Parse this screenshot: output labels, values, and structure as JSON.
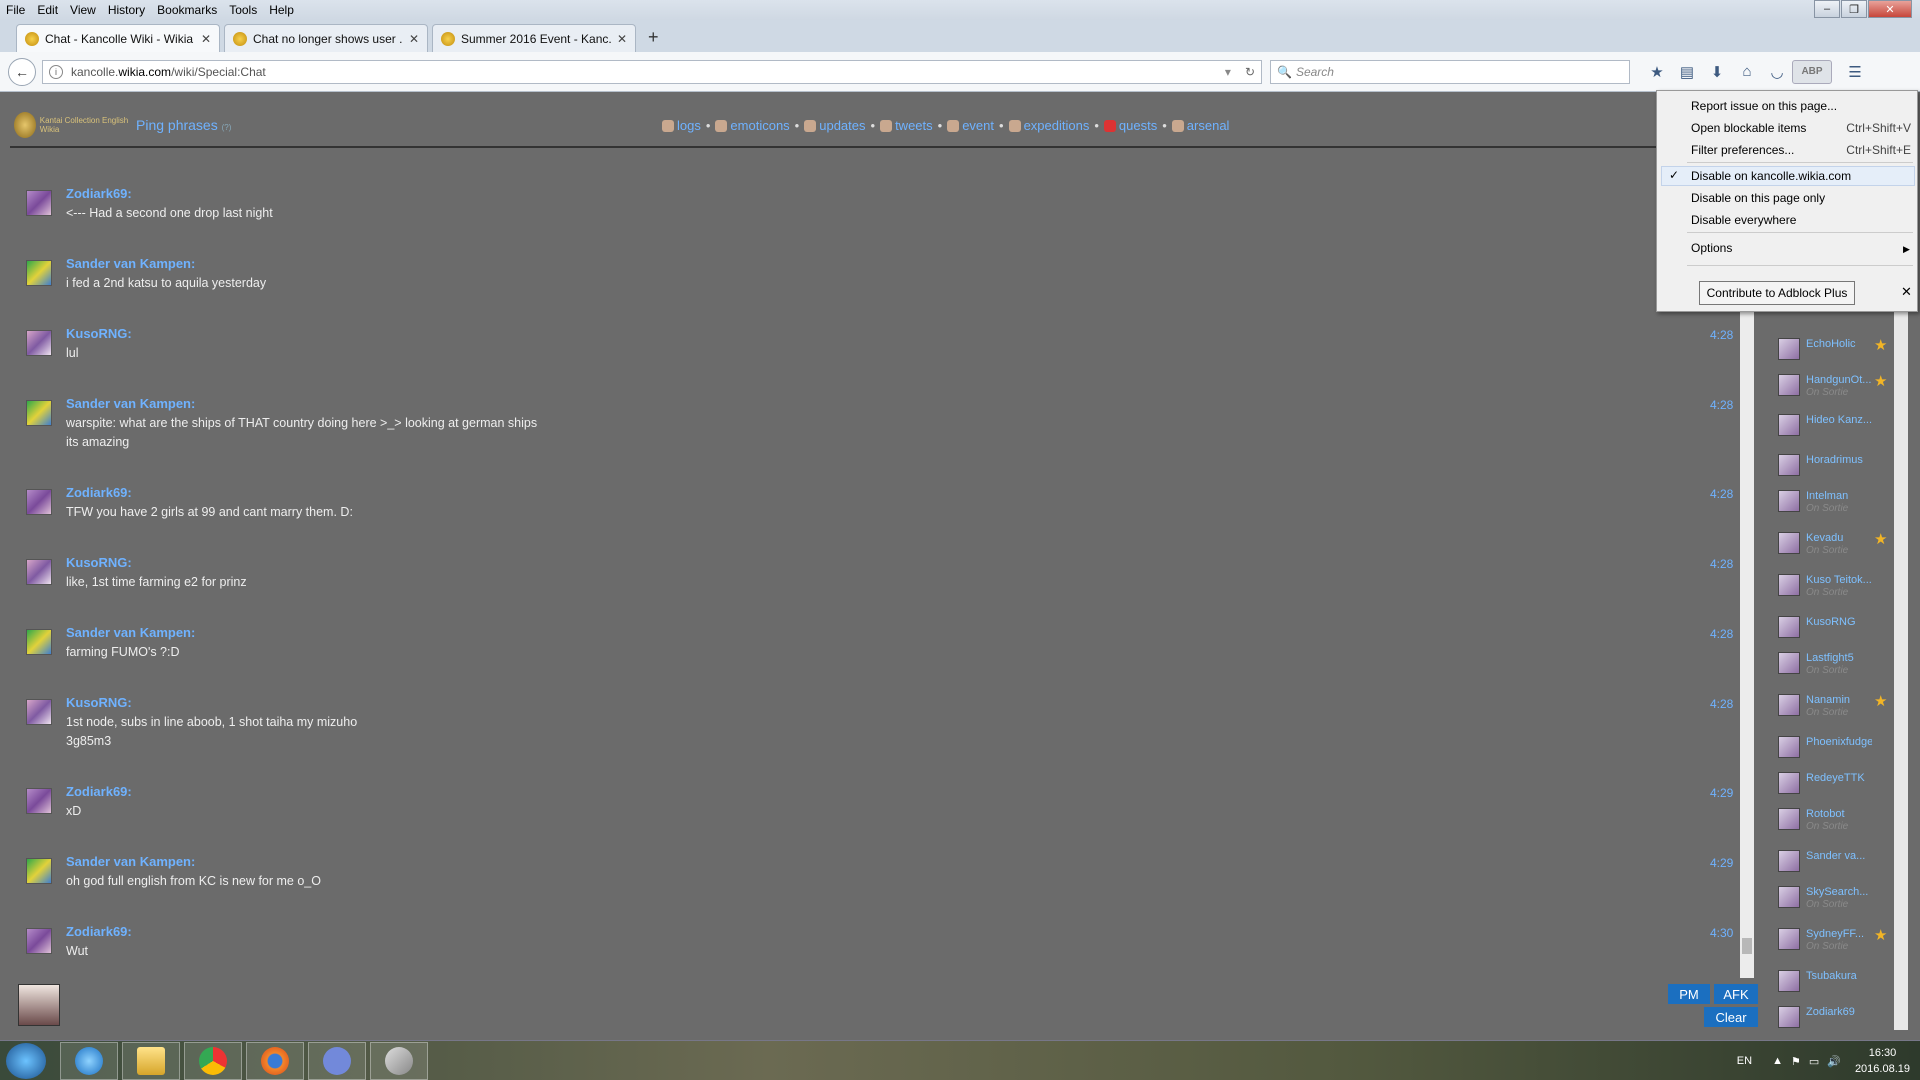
{
  "browser": {
    "menu": [
      "File",
      "Edit",
      "View",
      "History",
      "Bookmarks",
      "Tools",
      "Help"
    ],
    "window_controls": [
      "‒",
      "❐",
      "✕"
    ],
    "tabs": [
      {
        "title": "Chat - Kancolle Wiki - Wikia",
        "active": true
      },
      {
        "title": "Chat no longer shows user ...",
        "active": false
      },
      {
        "title": "Summer 2016 Event - Kanc...",
        "active": false
      }
    ],
    "new_tab": "+",
    "url_prefix": "kancolle.",
    "url_domain": "wikia.com",
    "url_path": "/wiki/Special:Chat",
    "search_placeholder": "Search",
    "abp_label": "ABP"
  },
  "chat": {
    "logo_text": "Kantai Collection English Wikia",
    "ping_phrases": "Ping phrases",
    "ping_hint": "(?)",
    "links": [
      "logs",
      "emoticons",
      "updates",
      "tweets",
      "event",
      "expeditions",
      "quests",
      "arsenal"
    ],
    "link_separator": "•",
    "messages": [
      {
        "user": "Zodiark69:",
        "lines": [
          "<--- Had a second one drop last night"
        ],
        "time": ""
      },
      {
        "user": "Sander van Kampen:",
        "lines": [
          "i fed a 2nd katsu to aquila yesterday"
        ],
        "time": ""
      },
      {
        "user": "KusoRNG:",
        "lines": [
          "lul"
        ],
        "time": "4:28"
      },
      {
        "user": "Sander van Kampen:",
        "lines": [
          "warspite: what are the ships of THAT country doing here >_> looking at german ships",
          "its amazing"
        ],
        "time": "4:28"
      },
      {
        "user": "Zodiark69:",
        "lines": [
          "TFW you have 2 girls at 99 and cant marry them. D:"
        ],
        "time": "4:28"
      },
      {
        "user": "KusoRNG:",
        "lines": [
          "like, 1st time farming e2 for prinz"
        ],
        "time": "4:28"
      },
      {
        "user": "Sander van Kampen:",
        "lines": [
          "farming FUMO's ?:D"
        ],
        "time": "4:28"
      },
      {
        "user": "KusoRNG:",
        "lines": [
          "1st node, subs in line aboob, 1 shot taiha my mizuho",
          "3g85m3"
        ],
        "time": "4:28"
      },
      {
        "user": "Zodiark69:",
        "lines": [
          "xD"
        ],
        "time": "4:29"
      },
      {
        "user": "Sander van Kampen:",
        "lines": [
          "oh god full english from KC is new for me o_O"
        ],
        "time": "4:29"
      },
      {
        "user": "Zodiark69:",
        "lines": [
          "Wut"
        ],
        "time": "4:30"
      }
    ],
    "buttons": {
      "pm": "PM",
      "afk": "AFK",
      "clear": "Clear"
    }
  },
  "userlist": [
    {
      "name": "EchoHolic",
      "status": "",
      "star": true
    },
    {
      "name": "HandgunOt...",
      "status": "On Sortie",
      "star": true
    },
    {
      "name": "Hideo Kanz...",
      "status": "",
      "star": false
    },
    {
      "name": "Horadrimus",
      "status": "",
      "star": false
    },
    {
      "name": "Intelman",
      "status": "On Sortie",
      "star": false
    },
    {
      "name": "Kevadu",
      "status": "On Sortie",
      "star": true
    },
    {
      "name": "Kuso Teitok...",
      "status": "On Sortie",
      "star": false
    },
    {
      "name": "KusoRNG",
      "status": "",
      "star": false
    },
    {
      "name": "Lastfight5",
      "status": "On Sortie",
      "star": false
    },
    {
      "name": "Nanamin",
      "status": "On Sortie",
      "star": true
    },
    {
      "name": "Phoenixfudge",
      "status": "",
      "star": false
    },
    {
      "name": "RedeyeTTK",
      "status": "",
      "star": false
    },
    {
      "name": "Rotobot",
      "status": "On Sortie",
      "star": false
    },
    {
      "name": "Sander va...",
      "status": "",
      "star": false
    },
    {
      "name": "SkySearch...",
      "status": "On Sortie",
      "star": false
    },
    {
      "name": "SydneyFF...",
      "status": "On Sortie",
      "star": true
    },
    {
      "name": "Tsubakura",
      "status": "",
      "star": false
    },
    {
      "name": "Zodiark69",
      "status": "",
      "star": false
    }
  ],
  "abp_menu": {
    "report": "Report issue on this page...",
    "blockable": "Open blockable items",
    "blockable_shortcut": "Ctrl+Shift+V",
    "filter": "Filter preferences...",
    "filter_shortcut": "Ctrl+Shift+E",
    "disable_site": "Disable on kancolle.wikia.com",
    "disable_page": "Disable on this page only",
    "disable_all": "Disable everywhere",
    "options": "Options",
    "contribute": "Contribute to Adblock Plus",
    "check": "✓",
    "close": "✕"
  },
  "taskbar": {
    "lang": "EN",
    "time": "16:30",
    "date": "2016.08.19"
  },
  "colors": {
    "link_blue": "#6fb2ff",
    "chat_bg": "#6b6b6b",
    "button_blue": "#1b6fc0",
    "star_gold": "#f2b526"
  }
}
